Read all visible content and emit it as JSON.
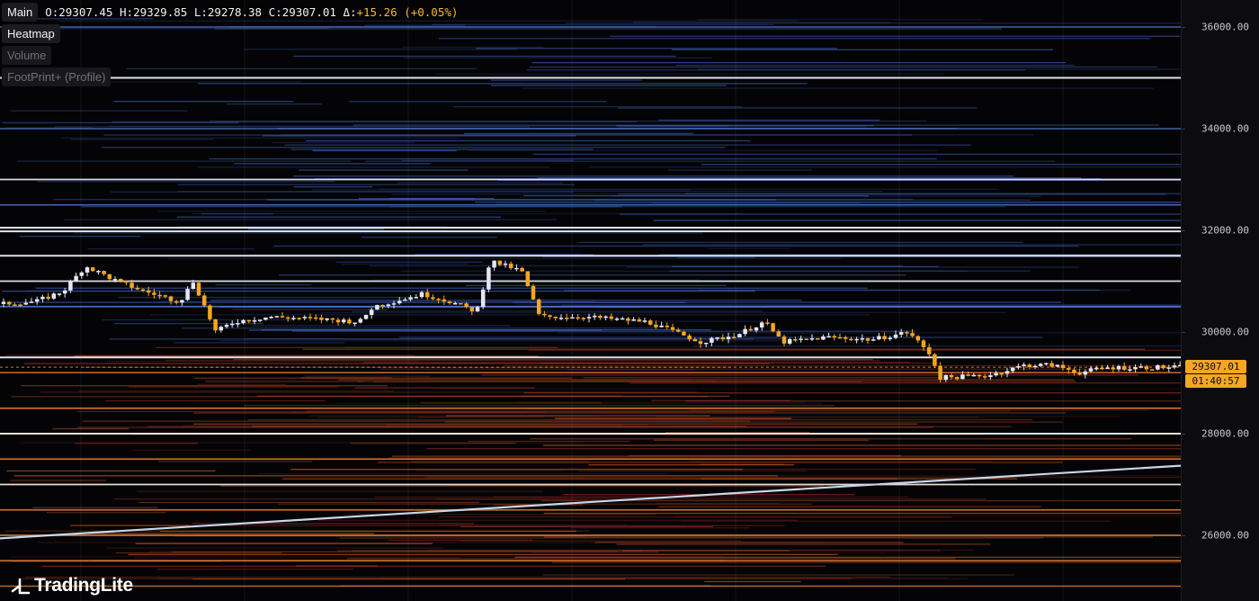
{
  "header": {
    "main_label": "Main",
    "ohlc": {
      "o_key": "O:",
      "o": "29307.45",
      "h_key": "H:",
      "h": "29329.85",
      "l_key": "L:",
      "l": "29278.38",
      "c_key": "C:",
      "c": "29307.01",
      "d_key": "Δ:",
      "d": "+15.26",
      "pct": "(+0.05%)"
    }
  },
  "layers": [
    {
      "label": "Heatmap",
      "active": true
    },
    {
      "label": "Volume",
      "active": false
    },
    {
      "label": "FootPrint+ (Profile)",
      "active": false
    }
  ],
  "price_axis": {
    "labels": [
      "36000.00",
      "34000.00",
      "32000.00",
      "30000.00",
      "28000.00",
      "26000.00"
    ],
    "current_price": "29307.01",
    "countdown": "01:40:57"
  },
  "logo": {
    "text": "TradingLite",
    "icon": "tradinglite-logo-icon"
  },
  "colors": {
    "up_candle": "#e6e6f5",
    "down_candle": "#f5a623",
    "accent": "#f5a623",
    "ask_liquidity": "#3b6fd1",
    "bid_liquidity": "#e0602a"
  },
  "chart_data": {
    "type": "candlestick",
    "price_range": [
      24900,
      36400
    ],
    "current_price": 29307.01,
    "heatmap_levels": [
      {
        "price": 36000,
        "strength": 0.5
      },
      {
        "price": 35000,
        "strength": 0.9
      },
      {
        "price": 34000,
        "strength": 0.5
      },
      {
        "price": 33000,
        "strength": 0.85
      },
      {
        "price": 32500,
        "strength": 0.6
      },
      {
        "price": 32050,
        "strength": 1.0
      },
      {
        "price": 31980,
        "strength": 0.95
      },
      {
        "price": 31500,
        "strength": 0.9
      },
      {
        "price": 31000,
        "strength": 0.85
      },
      {
        "price": 30500,
        "strength": 0.7
      },
      {
        "price": 29500,
        "strength": 0.9
      },
      {
        "price": 29200,
        "strength": 0.6
      },
      {
        "price": 28500,
        "strength": 0.8
      },
      {
        "price": 28000,
        "strength": 0.9
      },
      {
        "price": 27500,
        "strength": 0.7
      },
      {
        "price": 27000,
        "strength": 0.85
      },
      {
        "price": 26500,
        "strength": 0.7
      },
      {
        "price": 26000,
        "strength": 0.8
      },
      {
        "price": 25500,
        "strength": 0.7
      },
      {
        "price": 25000,
        "strength": 0.6
      }
    ],
    "trendline": {
      "start_price": 25940,
      "end_price": 27370
    }
  }
}
